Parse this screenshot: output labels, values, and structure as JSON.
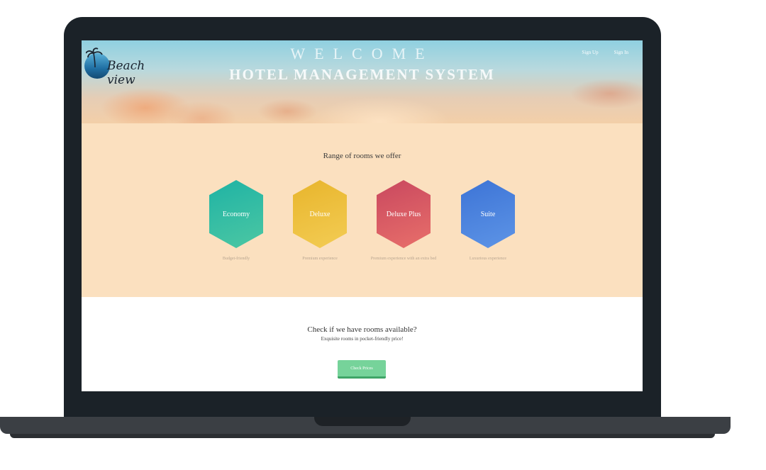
{
  "header": {
    "logo_text": "Beach view",
    "welcome": "WELCOME",
    "title": "HOTEL MANAGEMENT SYSTEM",
    "nav": {
      "sign_up": "Sign Up",
      "sign_in": "Sign In"
    }
  },
  "rooms": {
    "heading": "Range of rooms we offer",
    "items": [
      {
        "name": "Economy",
        "caption": "Budget-friendly",
        "color_top": "#1fb3a4",
        "color_bottom": "#4cc7a3"
      },
      {
        "name": "Deluxe",
        "caption": "Premium experience",
        "color_top": "#e8b52c",
        "color_bottom": "#f3cc54"
      },
      {
        "name": "Deluxe Plus",
        "caption": "Premium experience with an extra bed",
        "color_top": "#c9485f",
        "color_bottom": "#e86f6a"
      },
      {
        "name": "Suite",
        "caption": "Luxurious experience",
        "color_top": "#3d74d6",
        "color_bottom": "#5d94e6"
      }
    ]
  },
  "check": {
    "title": "Check if we have rooms available?",
    "subtitle": "Exquisite rooms in pocket-friendly price!",
    "button_label": "Check Prices"
  }
}
